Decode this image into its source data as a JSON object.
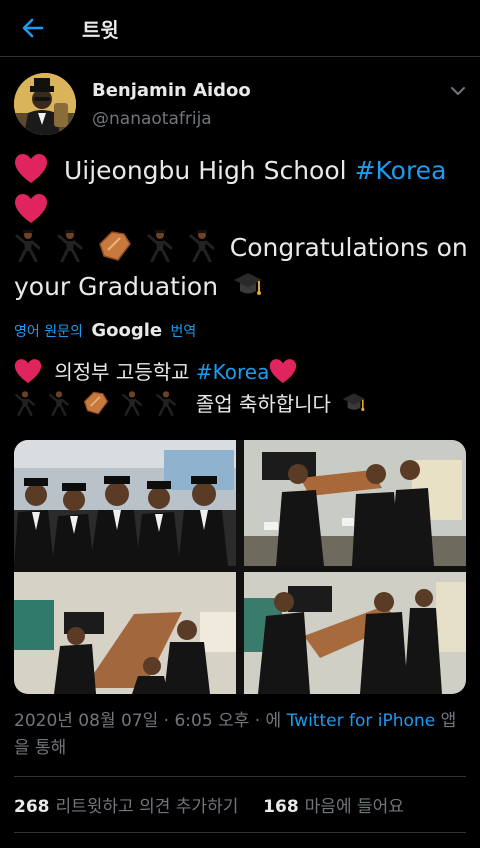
{
  "header": {
    "title": "트윗"
  },
  "author": {
    "name": "Benjamin Aidoo",
    "handle": "@nanaotafrija"
  },
  "tweet": {
    "line1_text": "Uijeongbu High School",
    "line1_hashtag": "#Korea",
    "line3_text": "Congratulations on",
    "line4_text": "your Graduation",
    "translate_prefix": "영어 원문의",
    "translate_brand": "Google",
    "translate_suffix": "번역",
    "ko_line1_text": "의정부 고등학교",
    "ko_line1_hashtag": "#Korea",
    "ko_line2_text": "졸업 축하합니다"
  },
  "meta": {
    "date": "2020년 08월 07일",
    "sep": "·",
    "time": "6:05 오후",
    "via_prefix": "· 에",
    "source": "Twitter for iPhone",
    "via_suffix": "앱을 통해"
  },
  "stats": {
    "retweets_count": "268",
    "retweets_label": "리트윗하고 의견 추가하기",
    "likes_count": "168",
    "likes_label": "마음에 들어요"
  },
  "colors": {
    "accent": "#1d9bf0",
    "heart": "#e0245e",
    "background": "#000000",
    "muted": "#71767b"
  },
  "icons": [
    "back-arrow-icon",
    "chevron-down-icon",
    "heart-emoji-icon",
    "dancer-emoji-icon",
    "coffin-emoji-icon",
    "graduation-cap-emoji-icon"
  ]
}
